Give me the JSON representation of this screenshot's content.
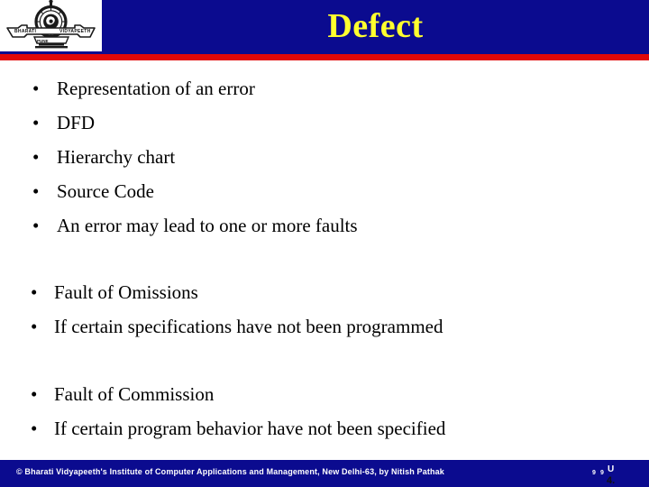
{
  "header": {
    "title": "Defect",
    "title_color": "#ffff2e",
    "band_color": "#0b0b8f",
    "rule_color": "#e10808",
    "logo": {
      "name": "bharati-vidyapeeth-emblem",
      "caption_left": "BHARATI",
      "caption_right": "VIDYAPEETH",
      "caption_bottom": "PUNE"
    }
  },
  "body": {
    "groups": [
      {
        "id": "group-a",
        "items": [
          {
            "marker": "•",
            "text": "Representation of an error"
          },
          {
            "marker": "•",
            "text": "DFD"
          },
          {
            "marker": "•",
            "text": "Hierarchy chart"
          },
          {
            "marker": "•",
            "text": "Source Code"
          },
          {
            "marker": "•",
            "text": "An error may lead to one or more faults"
          }
        ]
      },
      {
        "id": "group-b",
        "items": [
          {
            "marker": "•",
            "text": "Fault of Omissions"
          },
          {
            "marker": "•",
            "text": "If certain specifications have not been programmed"
          }
        ]
      },
      {
        "id": "group-c",
        "items": [
          {
            "marker": "•",
            "text": "Fault of Commission"
          },
          {
            "marker": "•",
            "text": "If certain program behavior have not been specified"
          }
        ]
      }
    ]
  },
  "footer": {
    "band_color": "#0b0b8f",
    "credit": "© Bharati Vidyapeeth's Institute of Computer Applications and Management, New Delhi-63, by  Nitish Pathak",
    "page_marks": {
      "a": "9",
      "b": "9",
      "c": "U",
      "d": "4."
    }
  }
}
